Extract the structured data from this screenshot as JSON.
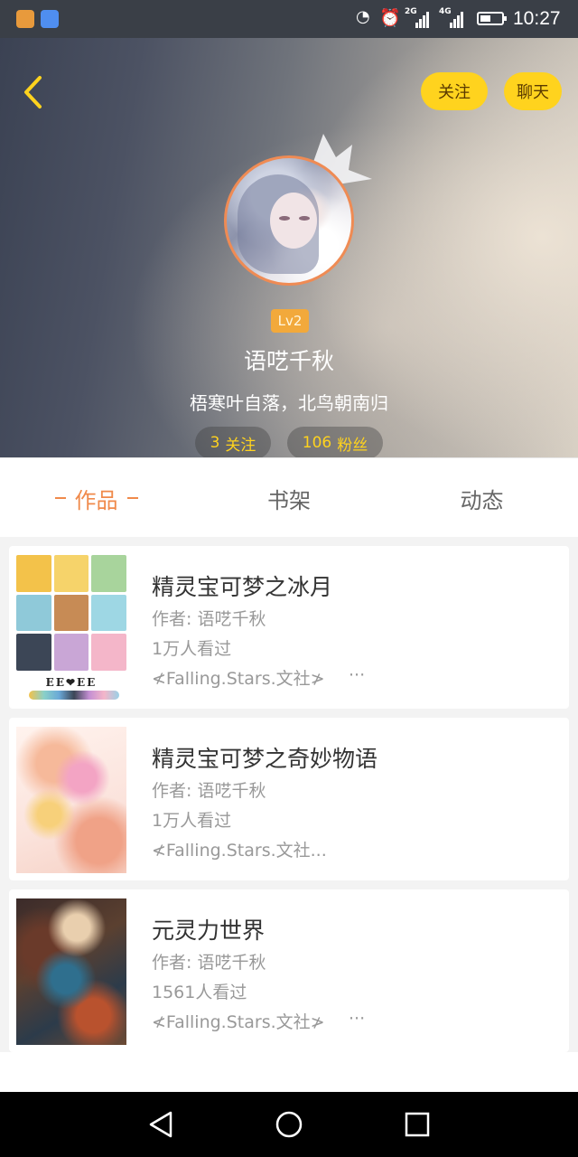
{
  "status_bar": {
    "time": "10:27",
    "network_2g": "2G",
    "network_4g": "4G",
    "icons": [
      "app-video-icon",
      "app-music-icon",
      "nfc-icon",
      "alarm-icon",
      "signal-icon",
      "battery-icon"
    ]
  },
  "header": {
    "follow_label": "关注",
    "chat_label": "聊天",
    "level": "Lv2",
    "username": "语呓千秋",
    "signature": "梧寒叶自落，北鸟朝南归",
    "following_count": "3",
    "following_label": "关注",
    "fans_count": "106",
    "fans_label": "粉丝"
  },
  "tabs": [
    {
      "label": "作品",
      "active": true
    },
    {
      "label": "书架",
      "active": false
    },
    {
      "label": "动态",
      "active": false
    }
  ],
  "books": [
    {
      "title": "精灵宝可梦之冰月",
      "author": "作者: 语呓千秋",
      "views": "1万人看过",
      "tag": "≮Falling.Stars.文社≯",
      "more": "···"
    },
    {
      "title": "精灵宝可梦之奇妙物语",
      "author": "作者: 语呓千秋",
      "views": "1万人看过",
      "tag": "≮Falling.Stars.文社...",
      "more": ""
    },
    {
      "title": "元灵力世界",
      "author": "作者: 语呓千秋",
      "views": "1561人看过",
      "tag": "≮Falling.Stars.文社≯",
      "more": "···"
    }
  ],
  "cover1_text": "EE❤EE",
  "colors": {
    "accent_yellow": "#ffd31e",
    "tab_active": "#f08a4b",
    "avatar_ring": "#ef8b54",
    "level_badge": "#f2a93b"
  }
}
